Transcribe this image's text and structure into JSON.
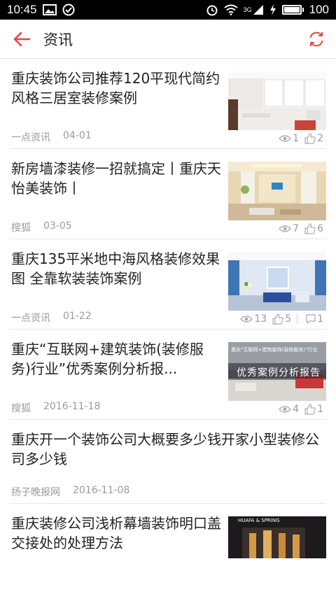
{
  "status_bar": {
    "time": "10:45",
    "network": "3G",
    "battery": "100",
    "battery_level": 1.0
  },
  "header": {
    "title": "资讯",
    "accent_color": "#e8453c"
  },
  "articles": [
    {
      "title": "重庆装饰公司推荐120平现代简约风格三居室装修案例",
      "source": "一点资讯",
      "date": "04-01",
      "views": "1",
      "likes": "2"
    },
    {
      "title": "新房墙漆装修一招就搞定丨重庆天怡美装饰丨",
      "source": "搜狐",
      "date": "03-05",
      "views": "7",
      "likes": "6"
    },
    {
      "title": "重庆135平米地中海风格装修效果图 全靠软装装饰案例",
      "source": "一点资讯",
      "date": "01-22",
      "views": "13",
      "likes": "5",
      "comments": "1"
    },
    {
      "title": "重庆“互联网+建筑装饰(装修服务)行业”优秀案例分析报...",
      "source": "搜狐",
      "date": "2016-11-18",
      "views": "4",
      "likes": "1",
      "thumb_text_top": "重庆“互联网+建筑装饰(装修服务)”行业",
      "thumb_text_main": "优秀案例分析报告"
    },
    {
      "title": "重庆开一个装饰公司大概要多少钱开家小型装修公司多少钱",
      "source": "扬子晚报网",
      "date": "2016-11-08"
    },
    {
      "title": "重庆装修公司浅析幕墙装饰明口盖交接处的处理方法",
      "thumb_text_top": "HUAFA & SPRING"
    }
  ]
}
